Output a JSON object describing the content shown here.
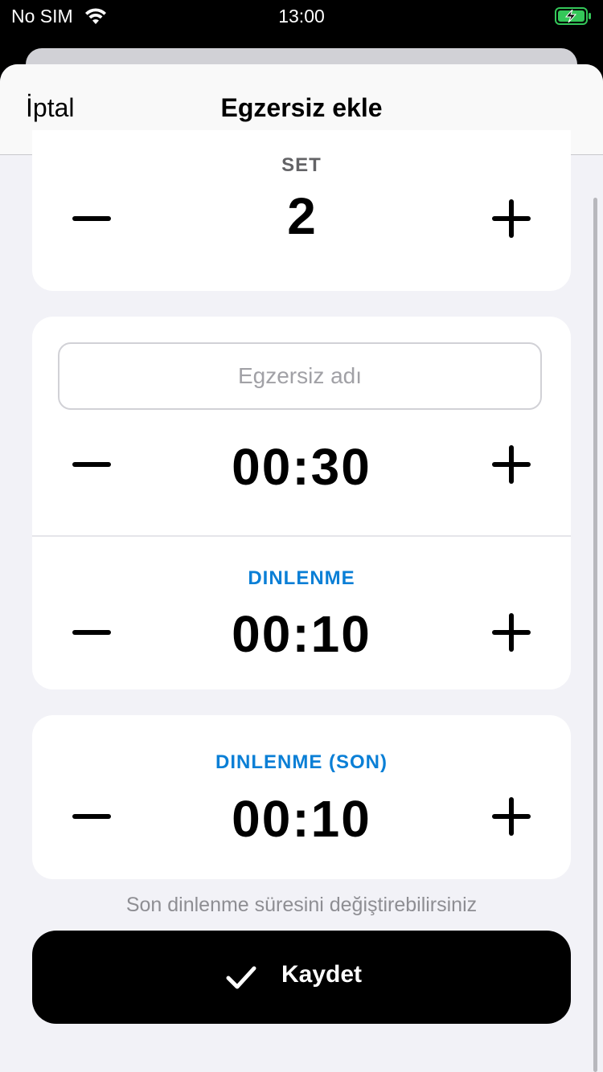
{
  "status_bar": {
    "carrier": "No SIM",
    "time": "13:00",
    "wifi_icon": "wifi-icon",
    "battery_icon": "battery-charging-icon",
    "battery_color": "#34c759"
  },
  "navbar": {
    "cancel_label": "İptal",
    "title": "Egzersiz ekle"
  },
  "set_card": {
    "label": "SET",
    "value": "2",
    "minus_icon": "minus-icon",
    "plus_icon": "plus-icon"
  },
  "exercise_card": {
    "name_placeholder": "Egzersiz adı",
    "name_value": "",
    "duration": "00:30",
    "rest_label": "DINLENME",
    "rest_duration": "00:10"
  },
  "last_rest_card": {
    "label": "DINLENME (SON)",
    "duration": "00:10"
  },
  "hint": "Son dinlenme süresini değiştirebilirsiniz",
  "save_button": {
    "label": "Kaydet",
    "icon": "checkmark-icon"
  },
  "colors": {
    "accent": "#0a7fd6",
    "background": "#f2f2f7",
    "card": "#ffffff",
    "primary_button": "#000000"
  }
}
